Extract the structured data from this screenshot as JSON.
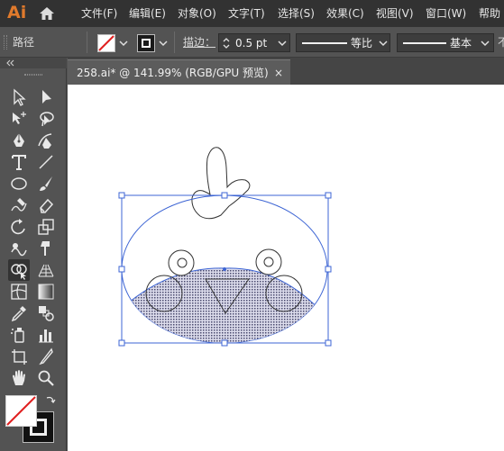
{
  "app": {
    "logo_text": "Ai"
  },
  "menu": {
    "items": [
      "文件(F)",
      "编辑(E)",
      "对象(O)",
      "文字(T)",
      "选择(S)",
      "效果(C)",
      "视图(V)",
      "窗口(W)",
      "帮助"
    ]
  },
  "control_bar": {
    "object_type": "路径",
    "stroke_label": "描边：",
    "stroke_weight": "0.5 pt",
    "profile_label": "等比",
    "brush_label": "基本",
    "trailing_label": "不"
  },
  "document": {
    "tab_title": "258.ai* @ 141.99% (RGB/GPU 预览)",
    "close_glyph": "×"
  },
  "colors": {
    "selection_blue": "#3c64d4",
    "app_bg": "#535353",
    "menubar_bg": "#323232",
    "logo_orange": "#e07a2c"
  },
  "tools": [
    "selection-tool",
    "direct-selection-tool",
    "magic-wand-tool",
    "lasso-tool",
    "pen-tool",
    "curvature-tool",
    "type-tool",
    "line-segment-tool",
    "ellipse-tool",
    "paintbrush-tool",
    "shaper-tool",
    "eraser-tool",
    "rotate-tool",
    "scale-tool",
    "warp-tool",
    "free-transform-tool",
    "shape-builder-tool",
    "perspective-grid-tool",
    "mesh-tool",
    "gradient-tool",
    "eyedropper-tool",
    "blend-tool",
    "symbol-sprayer-tool",
    "column-graph-tool",
    "artboard-tool",
    "slice-tool",
    "hand-tool",
    "zoom-tool"
  ]
}
